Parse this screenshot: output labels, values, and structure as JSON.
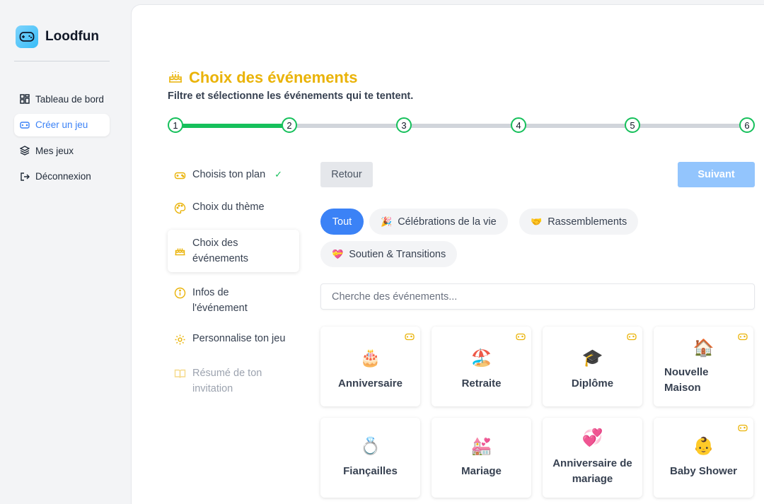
{
  "brand": {
    "name": "Loodfun"
  },
  "nav": [
    {
      "label": "Tableau de bord",
      "icon": "dashboard-icon",
      "active": false
    },
    {
      "label": "Créer un jeu",
      "icon": "gamepad-icon",
      "active": true
    },
    {
      "label": "Mes jeux",
      "icon": "layers-icon",
      "active": false
    },
    {
      "label": "Déconnexion",
      "icon": "logout-icon",
      "active": false
    }
  ],
  "header": {
    "title": "Choix des événements",
    "title_icon": "cake-icon",
    "subtitle": "Filtre et sélectionne les événements qui te tentent."
  },
  "stepper": {
    "steps": [
      "1",
      "2",
      "3",
      "4",
      "5",
      "6"
    ],
    "current": 2,
    "progress": 0.2
  },
  "steps_menu": [
    {
      "label": "Choisis ton plan",
      "icon": "gamepad-icon",
      "done": true
    },
    {
      "label": "Choix du thème",
      "icon": "palette-icon"
    },
    {
      "label": "Choix des événements",
      "icon": "cake-icon",
      "active": true
    },
    {
      "label": "Infos de l'événement",
      "icon": "info-icon"
    },
    {
      "label": "Personnalise ton jeu",
      "icon": "gear-icon"
    },
    {
      "label": "Résumé de ton invitation",
      "icon": "book-icon",
      "disabled": true
    }
  ],
  "actions": {
    "back": "Retour",
    "next": "Suivant"
  },
  "filters": [
    {
      "label": "Tout",
      "emoji": "",
      "active": true
    },
    {
      "label": "Célébrations de la vie",
      "emoji": "🎉"
    },
    {
      "label": "Rassemblements",
      "emoji": "🤝"
    },
    {
      "label": "Soutien & Transitions",
      "emoji": "💝"
    }
  ],
  "search": {
    "placeholder": "Cherche des événements..."
  },
  "events": [
    {
      "label": "Anniversaire",
      "emoji": "🎂",
      "badge": true
    },
    {
      "label": "Retraite",
      "emoji": "🏖️",
      "badge": true
    },
    {
      "label": "Diplôme",
      "emoji": "🎓",
      "badge": true
    },
    {
      "label": "Nouvelle Maison",
      "emoji": "🏠",
      "badge": true
    },
    {
      "label": "Fiançailles",
      "emoji": "💍",
      "badge": false
    },
    {
      "label": "Mariage",
      "emoji": "💒",
      "badge": false
    },
    {
      "label": "Anniversaire de mariage",
      "emoji": "💞",
      "badge": false
    },
    {
      "label": "Baby Shower",
      "emoji": "👶",
      "badge": true
    }
  ],
  "colors": {
    "accent": "#3b82f6",
    "title": "#eab308",
    "success": "#16c05b"
  }
}
